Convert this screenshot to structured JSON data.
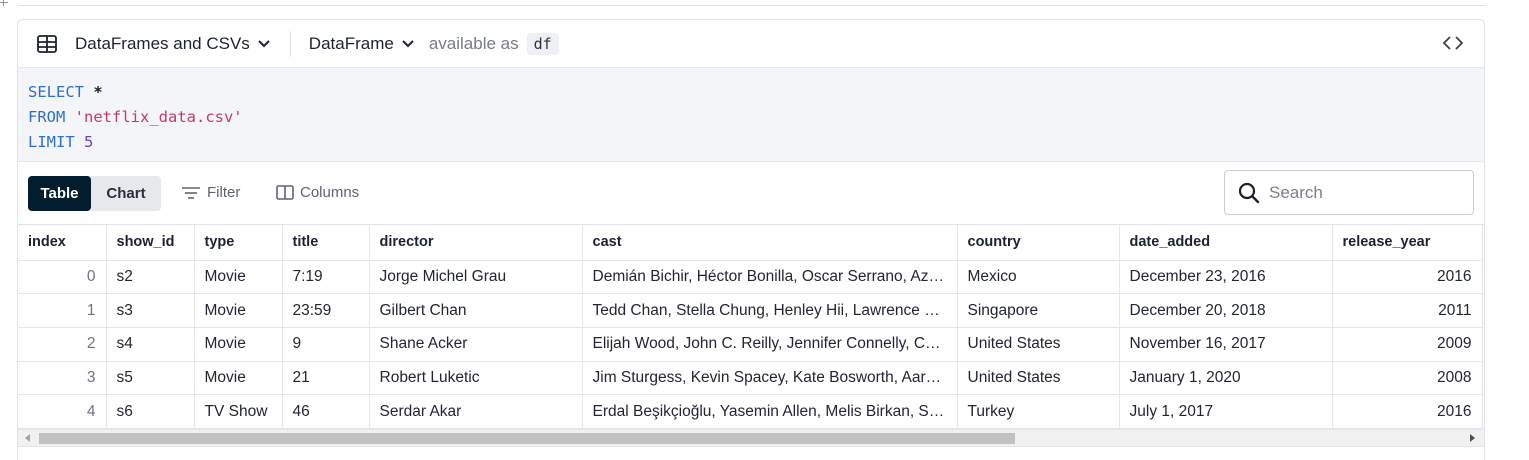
{
  "header": {
    "source_label": "DataFrames and CSVs",
    "output_label": "DataFrame",
    "available_as": "available as",
    "var_name": "df"
  },
  "code": {
    "line1": {
      "kw": "SELECT",
      "rest": "*"
    },
    "line2": {
      "kw": "FROM",
      "str": "'netflix_data.csv'"
    },
    "line3": {
      "kw": "LIMIT",
      "num": "5"
    }
  },
  "toolbar": {
    "table_label": "Table",
    "chart_label": "Chart",
    "filter_label": "Filter",
    "columns_label": "Columns",
    "search_placeholder": "Search",
    "active_view": "Table"
  },
  "table": {
    "columns": [
      "index",
      "show_id",
      "type",
      "title",
      "director",
      "cast",
      "country",
      "date_added",
      "release_year",
      ""
    ],
    "rows": [
      [
        "0",
        "s2",
        "Movie",
        "7:19",
        "Jorge Michel Grau",
        "Demián Bichir, Héctor Bonilla, Oscar Serrano, Azalia Ortiz",
        "Mexico",
        "December 23, 2016",
        "2016"
      ],
      [
        "1",
        "s3",
        "Movie",
        "23:59",
        "Gilbert Chan",
        "Tedd Chan, Stella Chung, Henley Hii, Lawrence Koh",
        "Singapore",
        "December 20, 2018",
        "2011"
      ],
      [
        "2",
        "s4",
        "Movie",
        "9",
        "Shane Acker",
        "Elijah Wood, John C. Reilly, Jennifer Connelly, Christopher Plummer",
        "United States",
        "November 16, 2017",
        "2009"
      ],
      [
        "3",
        "s5",
        "Movie",
        "21",
        "Robert Luketic",
        "Jim Sturgess, Kevin Spacey, Kate Bosworth, Aaron Yoo",
        "United States",
        "January 1, 2020",
        "2008"
      ],
      [
        "4",
        "s6",
        "TV Show",
        "46",
        "Serdar Akar",
        "Erdal Beşikçioğlu, Yasemin Allen, Melis Birkan, Saygın Soysal",
        "Turkey",
        "July 1, 2017",
        "2016"
      ]
    ]
  },
  "colors": {
    "accent_dark": "#031d2e",
    "keyword": "#2f6fc2",
    "string": "#c43a6a",
    "number": "#6b3fb8"
  }
}
